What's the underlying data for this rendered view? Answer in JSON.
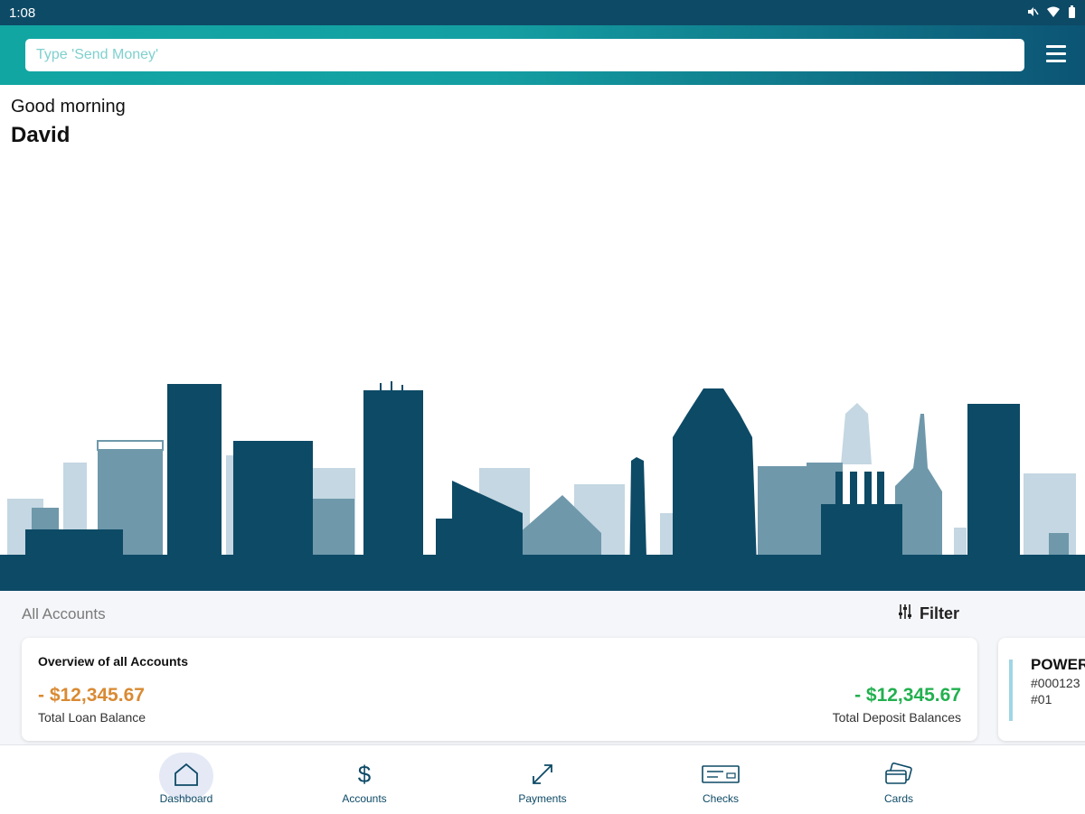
{
  "status_bar": {
    "time": "1:08",
    "icons": [
      "mute-icon",
      "wifi-icon",
      "battery-icon"
    ]
  },
  "search": {
    "placeholder": "Type 'Send Money'"
  },
  "greeting": {
    "salutation": "Good morning",
    "name": "David"
  },
  "accounts": {
    "section_title": "All Accounts",
    "filter_label": "Filter",
    "overview": {
      "title": "Overview of all Accounts",
      "loan_amount": "- $12,345.67",
      "loan_label": "Total Loan Balance",
      "deposit_amount": "- $12,345.67",
      "deposit_label": "Total Deposit Balances"
    },
    "account_card": {
      "name": "POWER",
      "number": "#000123",
      "suffix": "#01"
    }
  },
  "nav": {
    "items": [
      {
        "label": "Dashboard",
        "icon": "home-icon",
        "active": true
      },
      {
        "label": "Accounts",
        "icon": "dollar-icon",
        "active": false
      },
      {
        "label": "Payments",
        "icon": "transfer-arrows-icon",
        "active": false
      },
      {
        "label": "Checks",
        "icon": "check-icon",
        "active": false
      },
      {
        "label": "Cards",
        "icon": "cards-icon",
        "active": false
      }
    ]
  },
  "colors": {
    "brand_dark": "#0d4a66",
    "brand_teal": "#12a6a3",
    "loan": "#d98a33",
    "deposit": "#22b04f"
  }
}
